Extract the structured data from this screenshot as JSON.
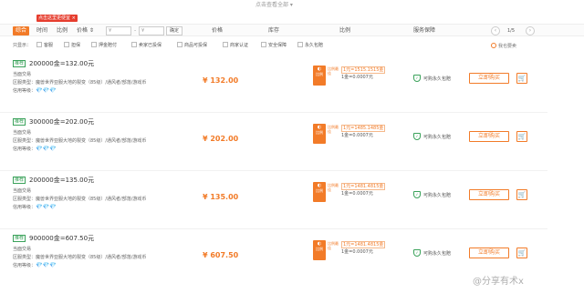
{
  "top": {
    "expand_text": "点击查看全部 ▾"
  },
  "promo": {
    "badge": "点击这里更便宜 ×"
  },
  "sort": {
    "tabs": [
      "综合",
      "时间",
      "比例"
    ],
    "price_label": "价格 ⇕",
    "min_placeholder": "¥",
    "max_placeholder": "¥",
    "separator": "-",
    "confirm": "确定"
  },
  "columns": {
    "price": "价格",
    "stock": "库存",
    "ratio": "比例",
    "service": "服务保障"
  },
  "pager": {
    "prev": "‹",
    "page_text": "1/5",
    "next": "›"
  },
  "filters": {
    "show_label": "只显示：",
    "options": [
      "客服",
      "担保",
      "押金赔付",
      "卖家已投保",
      "商品可投保",
      "商家认证",
      "安全保障",
      "永久包赔"
    ],
    "favorite": "我也要卖"
  },
  "listings": [
    {
      "tag": "推荐",
      "title": "200000金=132.00元",
      "trade_type": "当面交易",
      "region": "区服类型：魔兽世界亚服大地的裂变（85级）/通风者/部落/游戏币",
      "credit_label": "信用等级：",
      "credit_diamonds": "💎💎💎",
      "price": "¥ 132.00",
      "ratio_icon": "◐",
      "ratio_badge": "比例",
      "ratio_best": "比例最佳",
      "ratio_main": "1元=1515.1515金",
      "ratio_sub": "1金=0.0007元",
      "guarantee": "可购永久包赔",
      "buy": "立即购买",
      "cart": "🛒"
    },
    {
      "tag": "推荐",
      "title": "300000金=202.00元",
      "trade_type": "当面交易",
      "region": "区服类型：魔兽世界亚服大地的裂变（85级）/通风者/部落/游戏币",
      "credit_label": "信用等级：",
      "credit_diamonds": "💎💎💎",
      "price": "¥ 202.00",
      "ratio_icon": "◐",
      "ratio_badge": "比例",
      "ratio_best": "比例最佳",
      "ratio_main": "1元=1485.1485金",
      "ratio_sub": "1金=0.0007元",
      "guarantee": "可购永久包赔",
      "buy": "立即购买",
      "cart": "🛒"
    },
    {
      "tag": "推荐",
      "title": "200000金=135.00元",
      "trade_type": "当面交易",
      "region": "区服类型：魔兽世界亚服大地的裂变（85级）/通风者/部落/游戏币",
      "credit_label": "信用等级：",
      "credit_diamonds": "💎💎💎",
      "price": "¥ 135.00",
      "ratio_icon": "◐",
      "ratio_badge": "比例",
      "ratio_best": "比例最佳",
      "ratio_main": "1元=1481.4815金",
      "ratio_sub": "1金=0.0007元",
      "guarantee": "可购永久包赔",
      "buy": "立即购买",
      "cart": "🛒"
    },
    {
      "tag": "推荐",
      "title": "900000金=607.50元",
      "trade_type": "当面交易",
      "region": "区服类型：魔兽世界亚服大地的裂变（85级）/通风者/部落/游戏币",
      "credit_label": "信用等级：",
      "credit_diamonds": "💎💎💎",
      "price": "¥ 607.50",
      "ratio_icon": "◐",
      "ratio_badge": "比例",
      "ratio_best": "比例最佳",
      "ratio_main": "1元=1481.4815金",
      "ratio_sub": "1金=0.0007元",
      "guarantee": "可购永久包赔",
      "buy": "立即购买",
      "cart": "🛒"
    }
  ],
  "watermark": "@分享有术x",
  "colors": {
    "accent": "#f27b28",
    "promo_red": "#e63d2e",
    "green": "#3aa25a",
    "diamond": "#3f9be8"
  }
}
